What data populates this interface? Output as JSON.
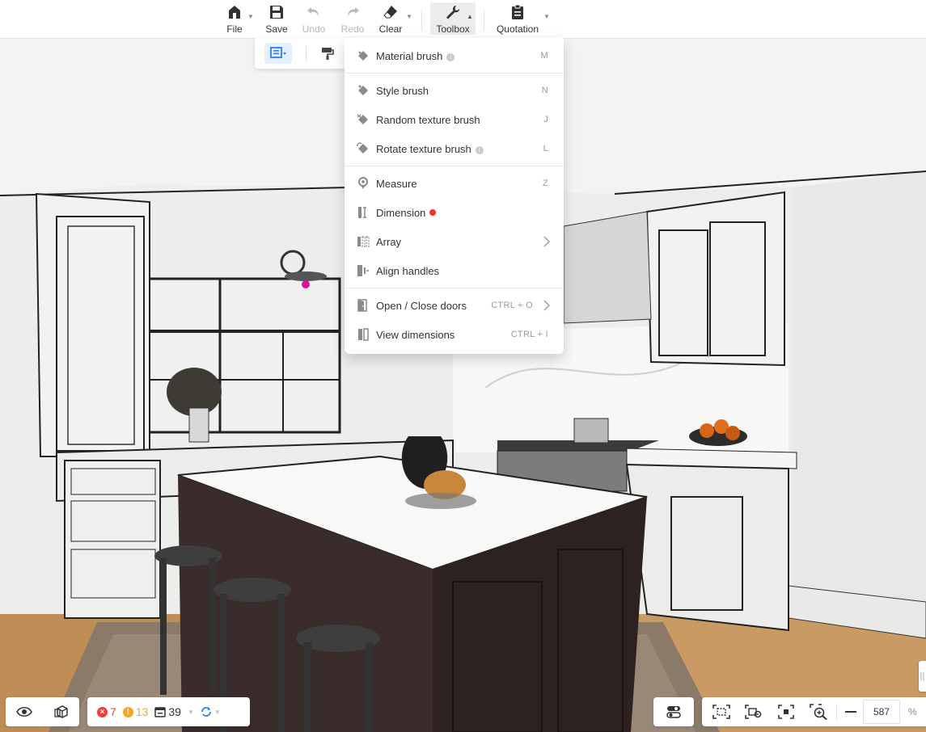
{
  "toolbar": {
    "file_label": "File",
    "save_label": "Save",
    "undo_label": "Undo",
    "redo_label": "Redo",
    "clear_label": "Clear",
    "toolbox_label": "Toolbox",
    "quotation_label": "Quotation"
  },
  "menu": {
    "items": [
      {
        "label": "Material brush",
        "shortcut": "M",
        "info": true
      },
      {
        "label": "Style brush",
        "shortcut": "N"
      },
      {
        "label": "Random texture brush",
        "shortcut": "J"
      },
      {
        "label": "Rotate texture brush",
        "shortcut": "L",
        "info": true
      },
      {
        "label": "Measure",
        "shortcut": "Z"
      },
      {
        "label": "Dimension",
        "dot_color": "#f5341f"
      },
      {
        "label": "Array",
        "submenu": true
      },
      {
        "label": "Align handles"
      },
      {
        "label": "Open / Close doors",
        "shortcut": "CTRL + O",
        "submenu": true
      },
      {
        "label": "View dimensions",
        "shortcut": "CTRL + I"
      }
    ]
  },
  "status": {
    "errors": "7",
    "warnings": "13",
    "items": "39",
    "error_color": "#f04134",
    "warning_color": "#f5a623",
    "accent_color": "#2f7cf6"
  },
  "zoom": {
    "value": "587",
    "unit": "%"
  },
  "icons": {
    "file": "home-icon",
    "save": "floppy-icon",
    "undo": "undo-icon",
    "redo": "redo-icon",
    "clear": "eraser-icon",
    "toolbox": "wrench-icon",
    "quotation": "clipboard-icon"
  }
}
